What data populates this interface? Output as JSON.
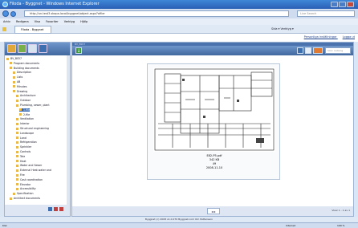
{
  "window": {
    "title": "Filoda - Byggnet - Windows Internet Explorer",
    "colors": {
      "titlebar": "#2a5fb5",
      "app_header": "#42699f",
      "selected": "#3567b3"
    }
  },
  "browser": {
    "address": "http://un-test3.skapa.local/byggnet/object.aspx?ofiler",
    "search_placeholder": "Live Search",
    "menu": [
      "Arkiv",
      "Redigera",
      "Visa",
      "Favoriter",
      "Verktyg",
      "Hjälp"
    ],
    "tab_label": "Filoda - Byggnet",
    "tools": "Sida ▾   Verktyg ▾"
  },
  "header": {
    "links": [
      "Personliga inställningar",
      "Logga ut"
    ]
  },
  "left_panel": {
    "icons": [
      "home-icon",
      "tree-icon",
      "mail-icon",
      "info-icon"
    ],
    "tree": [
      {
        "label": "BV_BS57",
        "indent": 0,
        "selected": false
      },
      {
        "label": "Program documents",
        "indent": 1,
        "selected": false
      },
      {
        "label": "Building documents",
        "indent": 1,
        "selected": false
      },
      {
        "label": "Description",
        "indent": 2,
        "selected": false
      },
      {
        "label": "Lists",
        "indent": 2,
        "selected": false
      },
      {
        "label": "AB",
        "indent": 2,
        "selected": false
      },
      {
        "label": "Minutes",
        "indent": 2,
        "selected": false
      },
      {
        "label": "Drawing",
        "indent": 2,
        "selected": false
      },
      {
        "label": "Architecture",
        "indent": 3,
        "selected": false
      },
      {
        "label": "Outdoor",
        "indent": 3,
        "selected": false
      },
      {
        "label": "Plumbing, sewer, plant",
        "indent": 3,
        "selected": false
      },
      {
        "label": "1-file",
        "indent": 4,
        "selected": true
      },
      {
        "label": "2-file",
        "indent": 4,
        "selected": false
      },
      {
        "label": "Ventilation",
        "indent": 3,
        "selected": false
      },
      {
        "label": "Interior",
        "indent": 3,
        "selected": false
      },
      {
        "label": "Structural engineering",
        "indent": 3,
        "selected": false
      },
      {
        "label": "Landscape",
        "indent": 3,
        "selected": false
      },
      {
        "label": "Land",
        "indent": 3,
        "selected": false
      },
      {
        "label": "Refrigeration",
        "indent": 3,
        "selected": false
      },
      {
        "label": "Sprinkler",
        "indent": 3,
        "selected": false
      },
      {
        "label": "Controls",
        "indent": 3,
        "selected": false
      },
      {
        "label": "Tele",
        "indent": 3,
        "selected": false
      },
      {
        "label": "Heat",
        "indent": 3,
        "selected": false
      },
      {
        "label": "Water and Sewer",
        "indent": 3,
        "selected": false
      },
      {
        "label": "External Heat water and",
        "indent": 3,
        "selected": false
      },
      {
        "label": "Fire",
        "indent": 3,
        "selected": false
      },
      {
        "label": "Cost coordination",
        "indent": 3,
        "selected": false
      },
      {
        "label": "Elevator",
        "indent": 3,
        "selected": false
      },
      {
        "label": "Accessibility",
        "indent": 3,
        "selected": false
      },
      {
        "label": "Specification",
        "indent": 2,
        "selected": false
      },
      {
        "label": "Architect documents",
        "indent": 1,
        "selected": false
      }
    ]
  },
  "main": {
    "strip_label": "BV_BS57",
    "search_placeholder": "Sök i katalog",
    "file": {
      "name": "E82-P5.pdf",
      "size": "342 KB",
      "version": "49",
      "date": "2008-11-10"
    },
    "page_info": "Visar 1 - 1 av 1"
  },
  "footer": {
    "text": "Byggnet (c) 2008  v1.0.270  Byggnet.com   Om Pettersson"
  },
  "status": {
    "left": "Klar",
    "zone": "Internet",
    "zoom": "100 %"
  }
}
